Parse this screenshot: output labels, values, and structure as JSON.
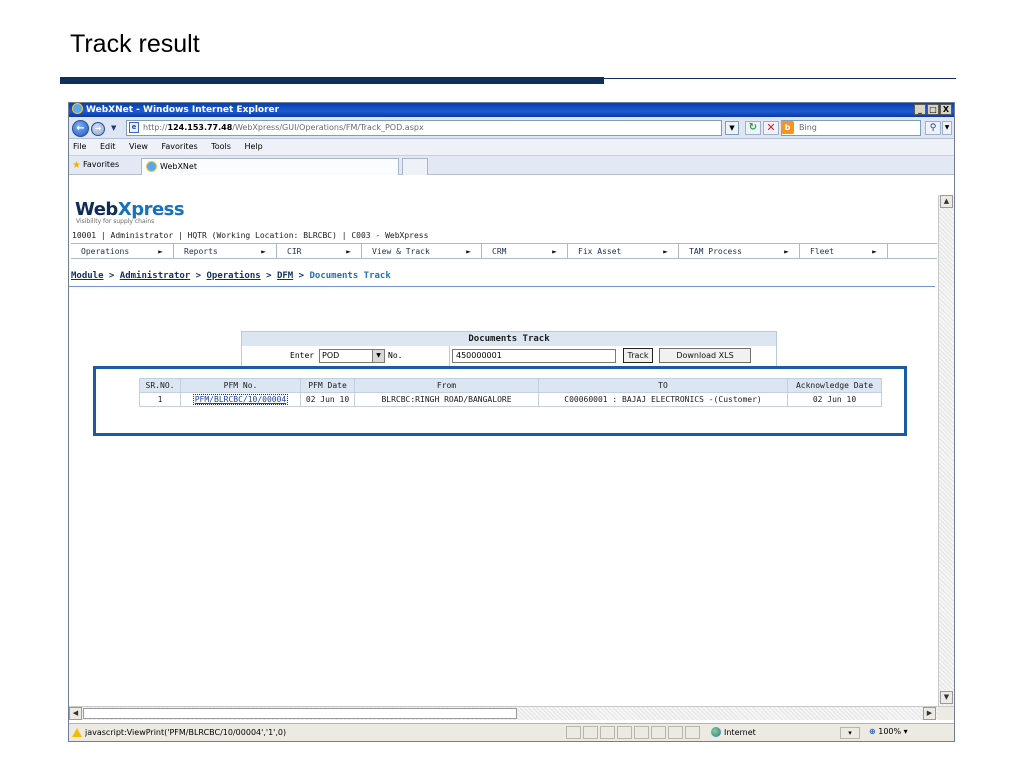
{
  "slide": {
    "title": "Track result"
  },
  "window": {
    "title": "WebXNet - Windows Internet Explorer",
    "buttons": [
      "_",
      "□",
      "X"
    ]
  },
  "addressbar": {
    "url_prefix": "http://",
    "url_host": "124.153.77.48",
    "url_path": "/WebXpress/GUI/Operations/FM/Track_POD.aspx",
    "search_placeholder": "Bing"
  },
  "menubar": {
    "items": [
      "File",
      "Edit",
      "View",
      "Favorites",
      "Tools",
      "Help"
    ]
  },
  "favorites_bar": {
    "label": "Favorites",
    "tab_title": "WebXNet"
  },
  "app": {
    "logo_main": "Web",
    "logo_accent": "Xpress",
    "tagline": "Visibility for supply chains",
    "userline": "10001 | Administrator | HQTR (Working Location: BLRCBC) | C003 - WebXpress",
    "nav": [
      "Operations",
      "Reports",
      "CIR",
      "View & Track",
      "CRM",
      "Fix Asset",
      "TAM Process",
      "Fleet"
    ],
    "breadcrumb": {
      "module": "Module",
      "administrator": "Administrator",
      "operations": "Operations",
      "dfm": "DFM",
      "current": "Documents Track",
      "sep": " > "
    }
  },
  "track_form": {
    "title": "Documents Track",
    "enter_label": "Enter",
    "type_value": "POD",
    "no_label": "No.",
    "number_value": "450000001",
    "track_button": "Track",
    "download_button": "Download XLS"
  },
  "results": {
    "columns": [
      "SR.NO.",
      "PFM No.",
      "PFM Date",
      "From",
      "TO",
      "Acknowledge Date"
    ],
    "rows": [
      {
        "sr": "1",
        "pfm_no": "PFM/BLRCBC/10/00004",
        "pfm_date": "02 Jun 10",
        "from": "BLRCBC:RINGH ROAD/BANGALORE",
        "to": "C00060001 : BAJAJ ELECTRONICS -(Customer)",
        "ack_date": "02 Jun 10"
      }
    ]
  },
  "statusbar": {
    "text": "javascript:ViewPrint('PFM/BLRCBC/10/00004','1',0)",
    "zone": "Internet",
    "zoom": "100%"
  }
}
